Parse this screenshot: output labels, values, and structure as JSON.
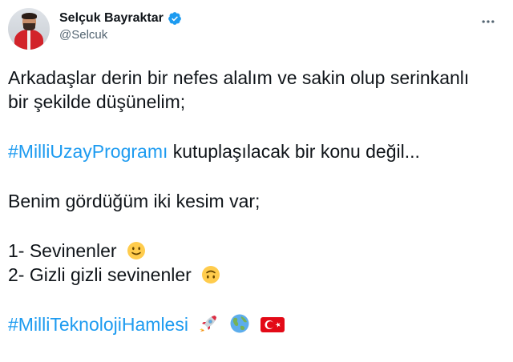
{
  "author": {
    "display_name": "Selçuk Bayraktar",
    "handle": "@Selcuk"
  },
  "tweet": {
    "line1": "Arkadaşlar derin bir nefes alalım ve sakin olup serinkanlı",
    "line2": "bir şekilde düşünelim;",
    "hashtag1": "#MilliUzayProgramı",
    "after_hashtag1": " kutuplaşılacak bir konu değil...",
    "line4": "Benim gördüğüm iki kesim var;",
    "item1": "1- Sevinenler",
    "item2": "2- Gizli gizli sevinenler",
    "hashtag2": "#MilliTeknolojiHamlesi"
  },
  "emojis": [
    "slightly-smiling-face",
    "upside-down-face",
    "rocket",
    "globe-earth",
    "turkish-flag"
  ],
  "colors": {
    "link": "#1d9bf0",
    "verified": "#1d9bf0",
    "text": "#0f1419",
    "secondary": "#536471"
  }
}
